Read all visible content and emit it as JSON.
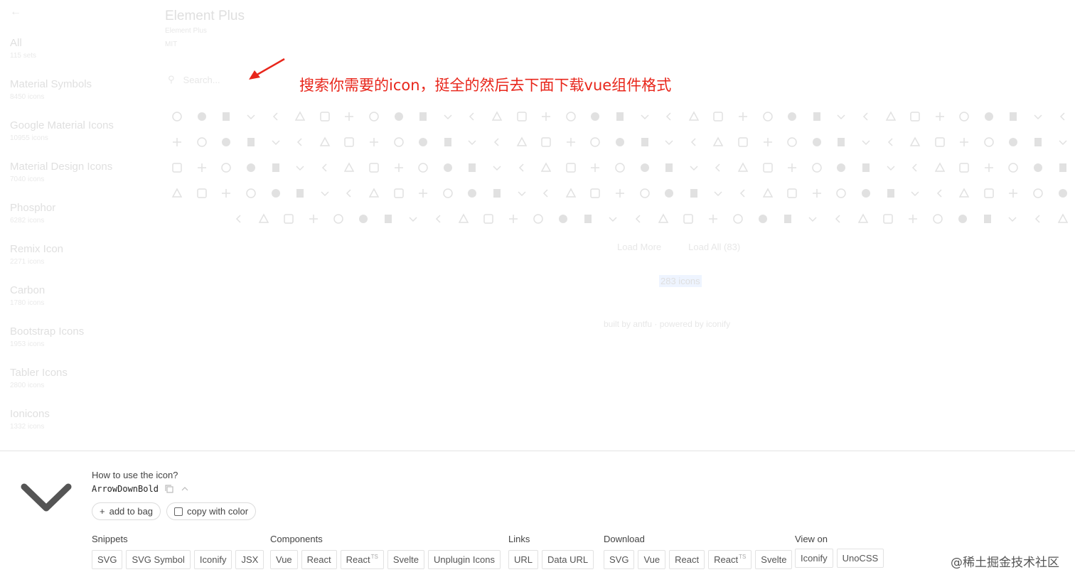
{
  "sidebar": {
    "collections": [
      {
        "name": "All",
        "count": "115 sets"
      },
      {
        "name": "Material Symbols",
        "count": "8450 icons"
      },
      {
        "name": "Google Material Icons",
        "count": "10955 icons"
      },
      {
        "name": "Material Design Icons",
        "count": "7040 icons"
      },
      {
        "name": "Phosphor",
        "count": "6282 icons"
      },
      {
        "name": "Remix Icon",
        "count": "2271 icons"
      },
      {
        "name": "Carbon",
        "count": "1780 icons"
      },
      {
        "name": "Bootstrap Icons",
        "count": "1953 icons"
      },
      {
        "name": "Tabler Icons",
        "count": "2800 icons"
      },
      {
        "name": "Ionicons",
        "count": "1332 icons"
      }
    ]
  },
  "main": {
    "title": "Element Plus",
    "subtitle": "Element Plus",
    "license": "MIT",
    "search_placeholder": "Search...",
    "load_more": "Load More",
    "load_all": "Load All (83)",
    "icon_count": "283 icons",
    "footer": "built by antfu · powered by iconify"
  },
  "annotation": {
    "text": "搜索你需要的icon，挺全的然后去下面下载vue组件格式",
    "color": "#e8261b"
  },
  "detail": {
    "how_to": "How to use the icon?",
    "icon_id": "ArrowDownBold",
    "add_to_bag": "add to bag",
    "copy_with_color": "copy with color",
    "groups": [
      {
        "label": "Snippets",
        "buttons": [
          {
            "text": "SVG"
          },
          {
            "text": "SVG Symbol"
          },
          {
            "text": "Iconify"
          },
          {
            "text": "JSX"
          }
        ]
      },
      {
        "label": "Components",
        "buttons": [
          {
            "text": "Vue"
          },
          {
            "text": "React"
          },
          {
            "text": "React",
            "sup": "TS"
          },
          {
            "text": "Svelte"
          },
          {
            "text": "Unplugin Icons"
          }
        ]
      },
      {
        "label": "Links",
        "buttons": [
          {
            "text": "URL"
          },
          {
            "text": "Data URL"
          }
        ]
      },
      {
        "label": "Download",
        "buttons": [
          {
            "text": "SVG"
          },
          {
            "text": "Vue"
          },
          {
            "text": "React"
          },
          {
            "text": "React",
            "sup": "TS"
          },
          {
            "text": "Svelte"
          }
        ]
      },
      {
        "label": "View on",
        "buttons": [
          {
            "text": "Iconify"
          },
          {
            "text": "UnoCSS"
          }
        ]
      }
    ]
  },
  "watermark": "@稀土掘金技术社区"
}
